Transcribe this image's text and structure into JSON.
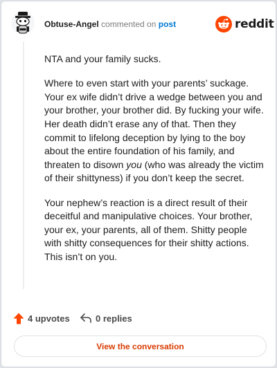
{
  "header": {
    "username": "Obtuse-Angel",
    "action_text": "commented on",
    "post_link": "post",
    "logo_word": "reddit"
  },
  "comment": {
    "paragraphs": [
      "NTA and your family sucks.",
      "Where to even start with your parents’ suckage. Your ex wife didn’t drive a wedge between you and your brother, your brother did. By fucking your wife. Her death didn’t erase any of that. Then they commit to lifelong deception by lying to the boy about the entire foundation of his family, and threaten to disown ",
      "you",
      " (who was already the victim of their shittyness) if you don’t keep the secret.",
      "Your nephew’s reaction is a direct result of their deceitful and manipulative choices. Your brother, your ex, your parents, all of them. Shitty people with shitty consequences for their shitty actions. This isn’t on you."
    ]
  },
  "footer": {
    "upvotes_label": "4 upvotes",
    "replies_label": "0 replies",
    "cta_label": "View the conversation"
  },
  "colors": {
    "brand_orange": "#ff4500",
    "link_blue": "#0079d3",
    "cta_text": "#d93a00"
  },
  "icons": {
    "avatar": "snoo-avatar-icon",
    "logo": "reddit-logo-icon",
    "upvote": "upvote-arrow-icon",
    "reply": "reply-arrow-icon"
  }
}
